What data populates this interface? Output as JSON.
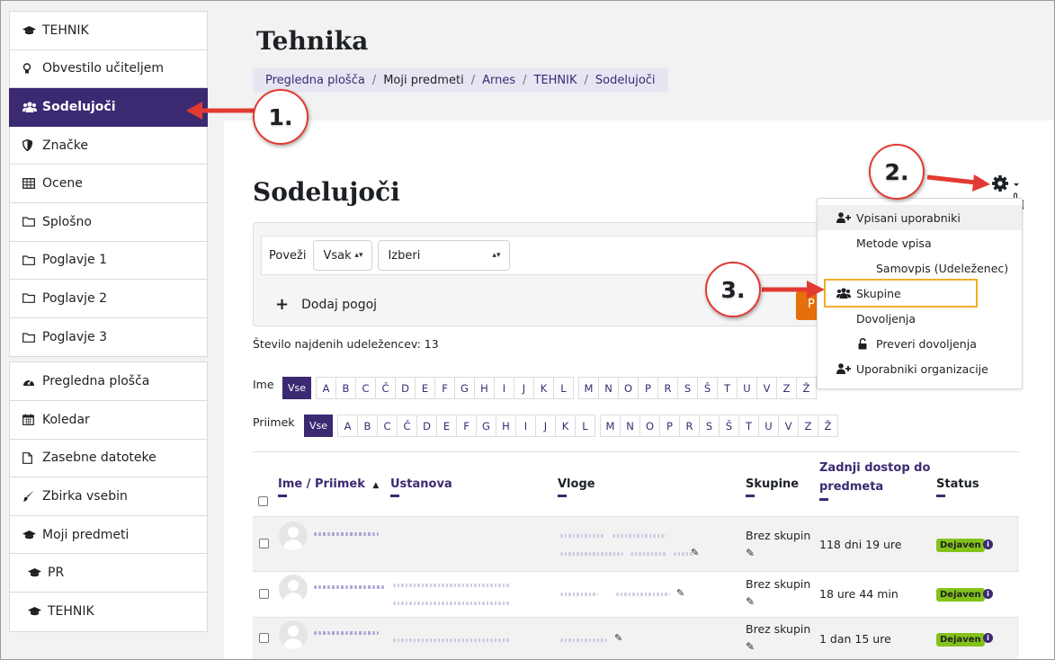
{
  "sidebar": {
    "course_items": [
      {
        "label": "TEHNIK",
        "icon": "graduation-cap-icon"
      },
      {
        "label": "Obvestilo učiteljem",
        "icon": "lightbulb-icon"
      },
      {
        "label": "Sodelujoči",
        "icon": "users-icon",
        "active": true
      },
      {
        "label": "Značke",
        "icon": "shield-icon"
      },
      {
        "label": "Ocene",
        "icon": "table-icon"
      },
      {
        "label": "Splošno",
        "icon": "folder-icon"
      },
      {
        "label": "Poglavje 1",
        "icon": "folder-icon"
      },
      {
        "label": "Poglavje 2",
        "icon": "folder-icon"
      },
      {
        "label": "Poglavje 3",
        "icon": "folder-icon"
      }
    ],
    "site_items": [
      {
        "label": "Pregledna plošča",
        "icon": "dashboard-icon"
      },
      {
        "label": "Koledar",
        "icon": "calendar-icon"
      },
      {
        "label": "Zasebne datoteke",
        "icon": "file-icon"
      },
      {
        "label": "Zbirka vsebin",
        "icon": "paintbrush-icon"
      },
      {
        "label": "Moji predmeti",
        "icon": "graduation-cap-icon"
      },
      {
        "label": "PR",
        "icon": "graduation-cap-icon"
      },
      {
        "label": "TEHNIK",
        "icon": "graduation-cap-icon"
      }
    ]
  },
  "header": {
    "course_title": "Tehnika",
    "breadcrumb": [
      "Pregledna plošča",
      "Moji predmeti",
      "Arnes",
      "TEHNIK",
      "Sodelujoči"
    ]
  },
  "page": {
    "title": "Sodelujoči",
    "filter": {
      "match_label": "Poveži",
      "match_value": "Vsak",
      "select_value": "Izberi",
      "add_condition": "Dodaj pogoj",
      "apply_partial": "P"
    },
    "count_text": "Število najdenih udeležencev: 13",
    "first_name_label": "Ime",
    "last_name_label": "Priimek",
    "all_label": "Vse",
    "letters": [
      "A",
      "B",
      "C",
      "Č",
      "D",
      "E",
      "F",
      "G",
      "H",
      "I",
      "J",
      "K",
      "L",
      "M",
      "N",
      "O",
      "P",
      "R",
      "S",
      "Š",
      "T",
      "U",
      "V",
      "Z",
      "Ž"
    ]
  },
  "table": {
    "headers": {
      "name": "Ime / Priimek",
      "institution": "Ustanova",
      "roles": "Vloge",
      "groups": "Skupine",
      "last_access_line1": "Zadnji dostop do",
      "last_access_line2": "predmeta",
      "status": "Status"
    },
    "rows": [
      {
        "groups": "Brez skupin",
        "last_access": "118 dni 19 ure",
        "status": "Dejaven"
      },
      {
        "groups": "Brez skupin",
        "last_access": "18 ure 44 min",
        "status": "Dejaven"
      },
      {
        "groups": "Brez skupin",
        "last_access": "1 dan 15 ure",
        "status": "Dejaven"
      }
    ]
  },
  "dropdown": {
    "items": [
      {
        "label": "Vpisani uporabniki",
        "icon": "user-plus-icon"
      },
      {
        "label": "Metode vpisa",
        "icon": ""
      },
      {
        "label": "Samovpis (Udeleženec)",
        "icon": ""
      },
      {
        "label": "Skupine",
        "icon": "users-icon"
      },
      {
        "label": "Dovoljenja",
        "icon": ""
      },
      {
        "label": "Preveri dovoljenja",
        "icon": "unlock-icon"
      },
      {
        "label": "Uporabniki organizacije",
        "icon": "user-plus-icon"
      }
    ]
  },
  "annotations": {
    "step1": "1.",
    "step2": "2.",
    "step3": "3."
  },
  "colors": {
    "primary": "#3b2a72",
    "active_badge": "#84c21a",
    "highlight_border": "#f0ad2b",
    "annotation_red": "#e23a32",
    "apply_button": "#e46f0b"
  }
}
